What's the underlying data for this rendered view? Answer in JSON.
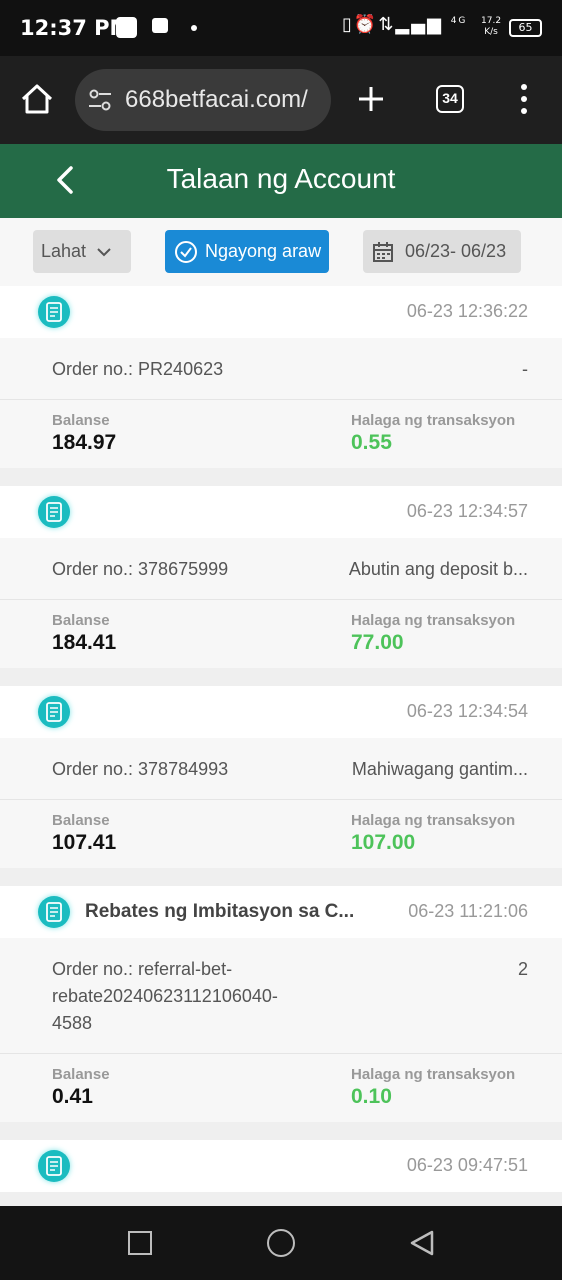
{
  "status_bar": {
    "time": "12:37 PM",
    "network_type": "4G",
    "speed_value": "17.2",
    "speed_unit": "K/s",
    "battery": "65"
  },
  "browser": {
    "url": "668betfacai.com/",
    "tab_count": "34"
  },
  "header": {
    "title": "Talaan ng Account"
  },
  "filters": {
    "type_label": "Lahat",
    "today_label": "Ngayong araw",
    "date_range": "06/23- 06/23"
  },
  "records": [
    {
      "title": "",
      "time": "06-23 12:36:22",
      "order": "Order no.: PR240623",
      "detail": "-",
      "balance_label": "Balanse",
      "balance": "184.97",
      "amount_label": "Halaga ng transaksyon",
      "amount": "0.55"
    },
    {
      "title": "",
      "time": "06-23 12:34:57",
      "order": "Order no.: 378675999",
      "detail": "Abutin ang deposit b...",
      "balance_label": "Balanse",
      "balance": "184.41",
      "amount_label": "Halaga ng transaksyon",
      "amount": "77.00"
    },
    {
      "title": "",
      "time": "06-23 12:34:54",
      "order": "Order no.: 378784993",
      "detail": "Mahiwagang gantim...",
      "balance_label": "Balanse",
      "balance": "107.41",
      "amount_label": "Halaga ng transaksyon",
      "amount": "107.00"
    },
    {
      "title": "Rebates ng Imbitasyon sa C...",
      "time": "06-23 11:21:06",
      "order": "Order no.: referral-bet-rebate20240623112106040-4588",
      "detail": "2",
      "balance_label": "Balanse",
      "balance": "0.41",
      "amount_label": "Halaga ng transaksyon",
      "amount": "0.10"
    },
    {
      "title": "",
      "time": "06-23 09:47:51"
    }
  ],
  "colors": {
    "header_green": "#246b47",
    "accent_blue": "#1a8ad6",
    "amount_green": "#4dc35a",
    "icon_teal": "#1bbcc0"
  },
  "icons": {
    "home": "home-icon",
    "tune": "site-settings-icon",
    "plus": "new-tab-icon",
    "menu": "more-vert-icon",
    "back": "back-chevron-icon",
    "calendar": "calendar-icon",
    "check": "check-circle-icon",
    "record": "receipt-icon"
  }
}
